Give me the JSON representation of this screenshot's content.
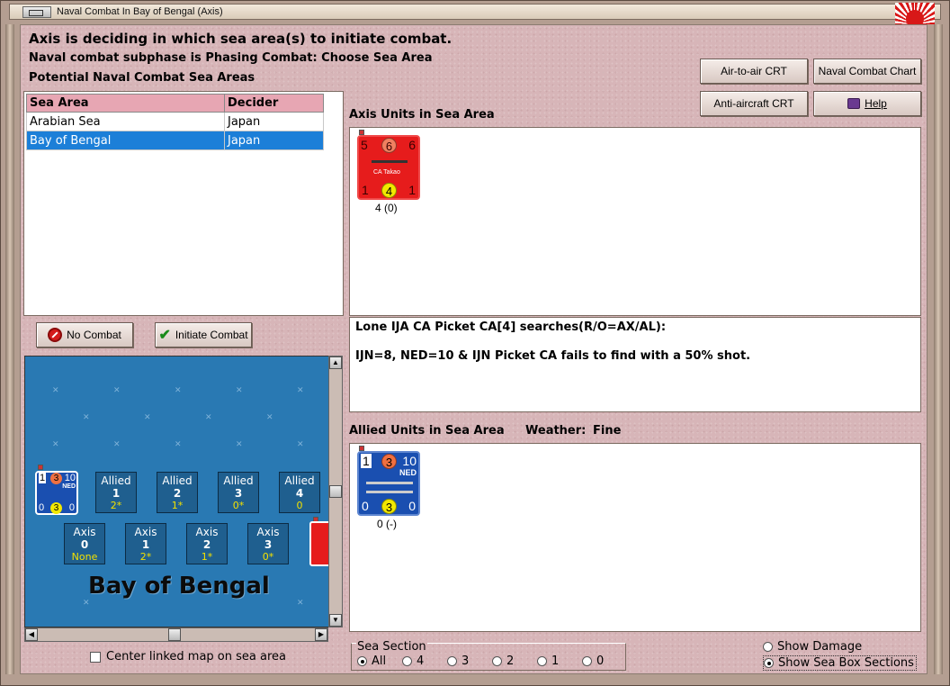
{
  "window": {
    "title": "Naval Combat In Bay of Bengal (Axis)"
  },
  "header": {
    "line1": "Axis is deciding in which sea area(s) to initiate combat.",
    "line2": "Naval combat subphase is Phasing Combat: Choose Sea Area",
    "line3": "Potential Naval Combat Sea Areas"
  },
  "buttons": {
    "air_to_air": "Air-to-air CRT",
    "naval_chart": "Naval Combat Chart",
    "anti_aircraft": "Anti-aircraft CRT",
    "help": "Help",
    "no_combat": "No Combat",
    "initiate_combat": "Initiate Combat"
  },
  "sea_table": {
    "headers": [
      "Sea Area",
      "Decider"
    ],
    "rows": [
      {
        "area": "Arabian Sea",
        "decider": "Japan"
      },
      {
        "area": "Bay of Bengal",
        "decider": "Japan",
        "selected": true
      }
    ]
  },
  "axis_units": {
    "label": "Axis Units in Sea Area",
    "counter": {
      "tl": "5",
      "tc": "6",
      "tr": "6",
      "name": "CA Takao",
      "bl": "1",
      "bc": "4",
      "br": "1",
      "caption": "4 (0)"
    }
  },
  "message": {
    "line1": "Lone IJA CA Picket CA[4] searches(R/O=AX/AL):",
    "line2": "IJN=8, NED=10 & IJN Picket CA fails to find with a 50% shot."
  },
  "allied_units": {
    "label": "Allied Units in Sea Area",
    "weather_label": "Weather:",
    "weather_value": "Fine",
    "counter": {
      "tl": "1",
      "tc": "3",
      "tr": "10",
      "nation": "NED",
      "bl": "0",
      "bc": "3",
      "br": "0",
      "caption": "0 (-)"
    }
  },
  "map": {
    "title": "Bay of Bengal",
    "allied_boxes": [
      {
        "label": "Allied",
        "num": "1",
        "val": "2*"
      },
      {
        "label": "Allied",
        "num": "2",
        "val": "1*"
      },
      {
        "label": "Allied",
        "num": "3",
        "val": "0*"
      },
      {
        "label": "Allied",
        "num": "4",
        "val": "0"
      }
    ],
    "axis_boxes": [
      {
        "label": "Axis",
        "num": "0",
        "val": "None"
      },
      {
        "label": "Axis",
        "num": "1",
        "val": "2*"
      },
      {
        "label": "Axis",
        "num": "2",
        "val": "1*"
      },
      {
        "label": "Axis",
        "num": "3",
        "val": "0*"
      }
    ],
    "mini_counter": {
      "tl": "1",
      "tc": "3",
      "tr": "10",
      "nation": "NED",
      "bl": "0",
      "bc": "3",
      "br": "0"
    }
  },
  "center_linked": "Center linked map on sea area",
  "sea_section": {
    "title": "Sea Section",
    "options": [
      "All",
      "4",
      "3",
      "2",
      "1",
      "0"
    ],
    "selected": "All"
  },
  "display_options": {
    "show_damage": "Show Damage",
    "show_sections": "Show Sea Box Sections"
  },
  "colors": {
    "background": "#d7b5b8",
    "selected_row": "#1c7fd8",
    "axis_counter": "#e61c1c",
    "allied_counter": "#1a4fb0",
    "map_sea": "#2979b3"
  }
}
